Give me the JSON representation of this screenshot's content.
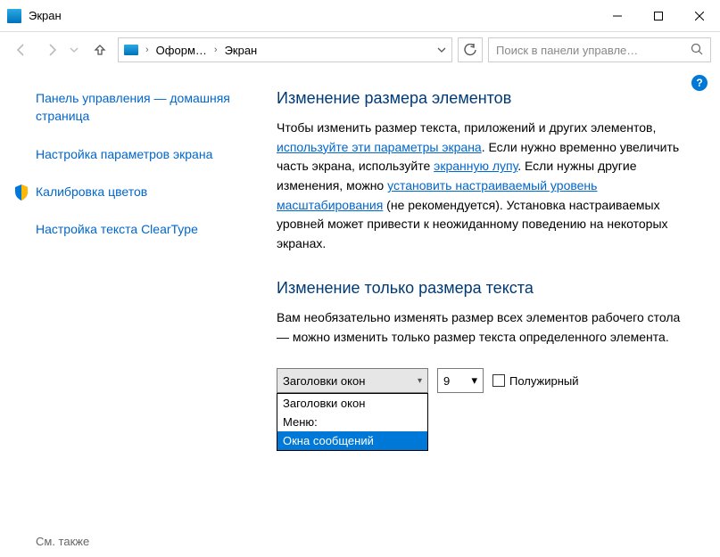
{
  "window": {
    "title": "Экран"
  },
  "nav": {
    "crumb1": "Оформ…",
    "crumb2": "Экран",
    "search_placeholder": "Поиск в панели управле…"
  },
  "sidebar": {
    "home": "Панель управления — домашняя страница",
    "display_settings": "Настройка параметров экрана",
    "color_calibration": "Калибровка цветов",
    "cleartype": "Настройка текста ClearType",
    "see_also": "См. также"
  },
  "content": {
    "h1": "Изменение размера элементов",
    "p1_a": "Чтобы изменить размер текста, приложений и других элементов, ",
    "link1": "используйте эти параметры экрана",
    "p1_b": ". Если нужно временно увеличить часть экрана, используйте ",
    "link2": "экранную лупу",
    "p1_c": ". Если нужны другие изменения, можно ",
    "link3": "установить настраиваемый уровень масштабирования",
    "p1_d": " (не рекомендуется). Установка настраиваемых уровней может привести к неожиданному поведению на некоторых экранах.",
    "h2": "Изменение только размера текста",
    "p2": "Вам необязательно изменять размер всех элементов рабочего стола — можно изменить только размер текста определенного элемента.",
    "element_selected": "Заголовки окон",
    "element_options": {
      "opt1": "Заголовки окон",
      "opt2": "Меню:",
      "opt3": "Окна сообщений"
    },
    "size_value": "9",
    "bold_label": "Полужирный"
  }
}
